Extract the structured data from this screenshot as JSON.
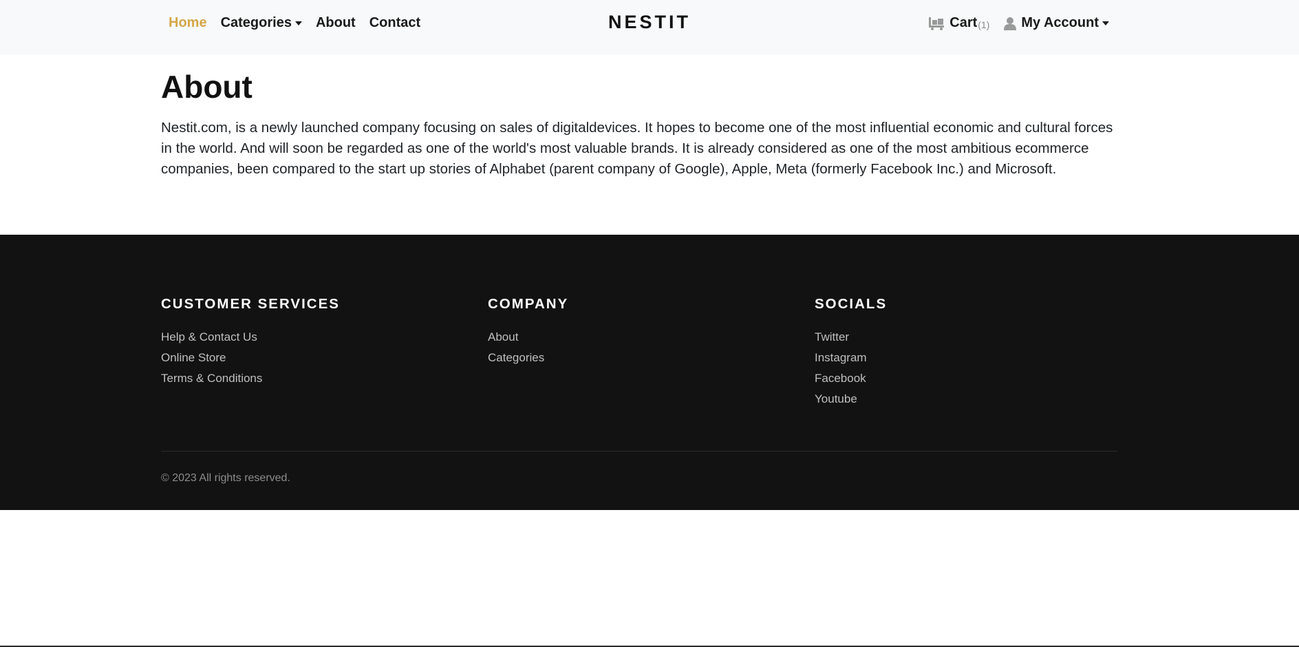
{
  "nav": {
    "links": [
      {
        "label": "Home"
      },
      {
        "label": "Categories"
      },
      {
        "label": "About"
      },
      {
        "label": "Contact"
      }
    ],
    "brand": "NESTIT",
    "cart_label": "Cart",
    "cart_count": "(1)",
    "account_label": "My Account"
  },
  "main": {
    "title": "About",
    "text": "Nestit.com, is a newly launched company focusing on sales of digitaldevices. It hopes to become one of the most influential economic and cultural forces in the world. And will soon be regarded as one of the world's most valuable brands. It is already considered as one of the most ambitious ecommerce companies, been compared to the start up stories of Alphabet (parent company of Google), Apple, Meta (formerly Facebook Inc.) and Microsoft."
  },
  "footer": {
    "columns": [
      {
        "heading": "CUSTOMER SERVICES",
        "links": [
          "Help & Contact Us",
          "Online Store",
          "Terms & Conditions"
        ]
      },
      {
        "heading": "COMPANY",
        "links": [
          "About",
          "Categories"
        ]
      },
      {
        "heading": "SOCIALS",
        "links": [
          "Twitter",
          "Instagram",
          "Facebook",
          "Youtube"
        ]
      }
    ],
    "copyright": "© 2023 All rights reserved."
  },
  "colors": {
    "accent": "#d4a74a",
    "navbar_bg": "#f8f9fa",
    "footer_bg": "#121212"
  },
  "icons": {
    "cart": "cart-icon",
    "account": "user-icon",
    "dropdown": "caret-down-icon"
  }
}
